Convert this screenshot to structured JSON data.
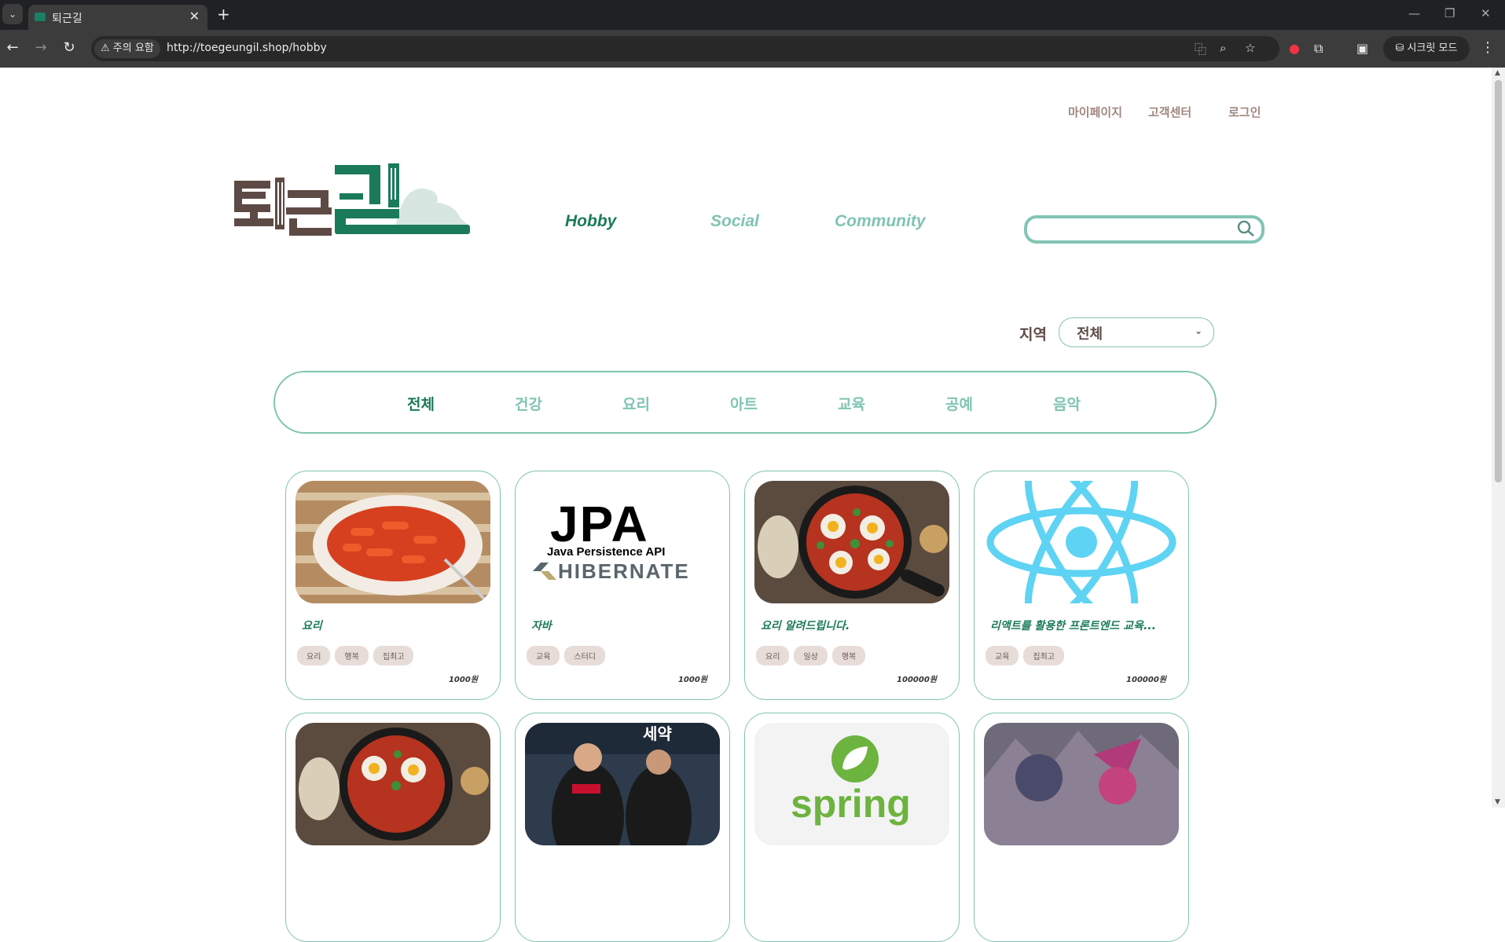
{
  "browser": {
    "tab_title": "퇴근길",
    "security_label": "주의 요함",
    "url": "http://toegeungil.shop/hobby",
    "incognito_label": "시크릿 모드",
    "icons": [
      "back-arrow-icon",
      "forward-arrow-icon",
      "reload-icon",
      "translate-icon",
      "zoom-icon",
      "star-icon",
      "extension-icon",
      "sidebar-icon",
      "menu-icon"
    ]
  },
  "header": {
    "links": [
      "마이페이지",
      "고객센터",
      "로그인"
    ],
    "logo_text": "퇴근길",
    "nav": [
      "Hobby",
      "Social",
      "Community"
    ],
    "search": {
      "value": "",
      "placeholder": ""
    }
  },
  "filter": {
    "region_label": "지역",
    "region_value": "전체",
    "categories": [
      "전체",
      "건강",
      "요리",
      "아트",
      "교육",
      "공예",
      "음악"
    ],
    "active_category": "전체"
  },
  "colors": {
    "brand_green": "#1b7a5a",
    "accent_mint": "#7fc4b2",
    "brown": "#5e4a45",
    "tag_bg": "#e7dcd8"
  },
  "cards": [
    {
      "title": "요리",
      "tags": [
        "요리",
        "행복",
        "집최고"
      ],
      "price": "1000원",
      "image": "tteokbokki"
    },
    {
      "title": "자바",
      "tags": [
        "교육",
        "스터디"
      ],
      "price": "1000원",
      "image": "jpa-hibernate",
      "image_text": {
        "big": "JPA",
        "sub": "Java Persistence API",
        "brand": "HIBERNATE"
      }
    },
    {
      "title": "요리 알려드립니다.",
      "tags": [
        "요리",
        "일상",
        "행복"
      ],
      "price": "100000원",
      "image": "shakshuka"
    },
    {
      "title": "리액트를 활용한 프론트엔드 교육...",
      "tags": [
        "교육",
        "집최고"
      ],
      "price": "100000원",
      "image": "react-logo"
    },
    {
      "title": "",
      "tags": [],
      "price": "",
      "image": "shakshuka"
    },
    {
      "title": "",
      "tags": [],
      "price": "",
      "image": "baseball",
      "image_text": {
        "sign": "세약"
      }
    },
    {
      "title": "",
      "tags": [],
      "price": "",
      "image": "spring-logo",
      "image_text": {
        "brand": "spring"
      }
    },
    {
      "title": "",
      "tags": [],
      "price": "",
      "image": "fantasy-art"
    }
  ]
}
